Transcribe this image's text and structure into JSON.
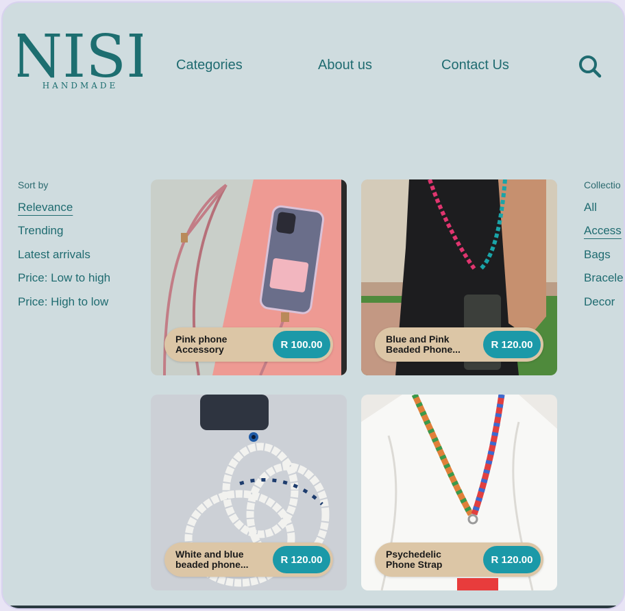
{
  "brand": {
    "name": "NISI",
    "tagline": "HANDMADE"
  },
  "nav": {
    "categories": "Categories",
    "about": "About us",
    "contact": "Contact Us",
    "search_icon": "search-icon"
  },
  "sort": {
    "title": "Sort by",
    "options": [
      "Relevance",
      "Trending",
      "Latest arrivals",
      "Price: Low to high",
      "Price: High to low"
    ],
    "selected": "Relevance"
  },
  "collections": {
    "title": "Collectio",
    "items": [
      "All",
      "Access",
      "Bags",
      "Bracele",
      "Decor"
    ],
    "selected": "Access"
  },
  "products": [
    {
      "name": "Pink phone\nAccessory",
      "price": "R 100.00"
    },
    {
      "name": "Blue and Pink\nBeaded Phone...",
      "price": "R 120.00"
    },
    {
      "name": "White and blue\nbeaded phone...",
      "price": "R 120.00"
    },
    {
      "name": "Psychedelic\nPhone Strap",
      "price": "R 120.00"
    }
  ],
  "colors": {
    "brand_teal": "#1f6b70",
    "price_pill": "#1b99a8",
    "name_pill": "#dcc6a6",
    "background": "#cfdcdf"
  }
}
